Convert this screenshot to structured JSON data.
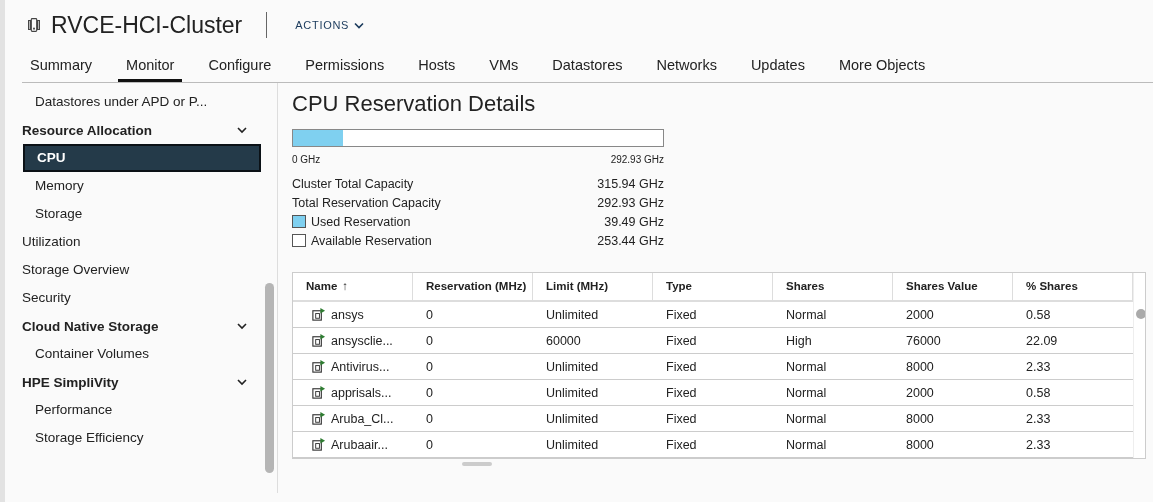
{
  "header": {
    "title": "RVCE-HCI-Cluster",
    "actions": "ACTIONS"
  },
  "tabs": [
    {
      "label": "Summary",
      "selected": false
    },
    {
      "label": "Monitor",
      "selected": true
    },
    {
      "label": "Configure",
      "selected": false
    },
    {
      "label": "Permissions",
      "selected": false
    },
    {
      "label": "Hosts",
      "selected": false
    },
    {
      "label": "VMs",
      "selected": false
    },
    {
      "label": "Datastores",
      "selected": false
    },
    {
      "label": "Networks",
      "selected": false
    },
    {
      "label": "Updates",
      "selected": false
    },
    {
      "label": "More Objects",
      "selected": false
    }
  ],
  "sidebar": {
    "items": [
      {
        "kind": "subitem",
        "label": "Datastores under APD or P...",
        "selected": false
      },
      {
        "kind": "group",
        "label": "Resource Allocation",
        "expanded": true,
        "children": [
          {
            "label": "CPU",
            "selected": true
          },
          {
            "label": "Memory",
            "selected": false
          },
          {
            "label": "Storage",
            "selected": false
          }
        ]
      },
      {
        "kind": "item",
        "label": "Utilization",
        "selected": false
      },
      {
        "kind": "item",
        "label": "Storage Overview",
        "selected": false
      },
      {
        "kind": "item",
        "label": "Security",
        "selected": false
      },
      {
        "kind": "group",
        "label": "Cloud Native Storage",
        "expanded": true,
        "children": [
          {
            "label": "Container Volumes",
            "selected": false
          }
        ]
      },
      {
        "kind": "group",
        "label": "HPE SimpliVity",
        "expanded": true,
        "children": [
          {
            "label": "Performance",
            "selected": false
          },
          {
            "label": "Storage Efficiency",
            "selected": false
          }
        ]
      }
    ]
  },
  "details": {
    "title": "CPU Reservation Details",
    "bar": {
      "level": 0.135,
      "min_label": "0 GHz",
      "max_label": "292.93 GHz"
    },
    "stats": [
      {
        "kind": "plain",
        "label": "Cluster Total Capacity",
        "value": "315.94 GHz"
      },
      {
        "kind": "plain",
        "label": "Total Reservation Capacity",
        "value": "292.93 GHz"
      },
      {
        "kind": "legend",
        "label": "Used Reservation",
        "value": "39.49 GHz",
        "color": "#7fd0f0"
      },
      {
        "kind": "legend",
        "label": "Available Reservation",
        "value": "253.44 GHz",
        "color": "#ffffff"
      }
    ]
  },
  "table": {
    "columns": [
      {
        "label": "Name",
        "sort_icon": "↑"
      },
      {
        "label": "Reservation (MHz)"
      },
      {
        "label": "Limit (MHz)"
      },
      {
        "label": "Type"
      },
      {
        "label": "Shares"
      },
      {
        "label": "Shares Value"
      },
      {
        "label": "% Shares"
      }
    ],
    "rows": [
      [
        "ansys",
        "0",
        "Unlimited",
        "Fixed",
        "Normal",
        "2000",
        "0.58"
      ],
      [
        "ansysclie...",
        "0",
        "60000",
        "Fixed",
        "High",
        "76000",
        "22.09"
      ],
      [
        "Antivirus...",
        "0",
        "Unlimited",
        "Fixed",
        "Normal",
        "8000",
        "2.33"
      ],
      [
        "apprisals...",
        "0",
        "Unlimited",
        "Fixed",
        "Normal",
        "2000",
        "0.58"
      ],
      [
        "Aruba_Cl...",
        "0",
        "Unlimited",
        "Fixed",
        "Normal",
        "8000",
        "2.33"
      ],
      [
        "Arubaair...",
        "0",
        "Unlimited",
        "Fixed",
        "Normal",
        "8000",
        "2.33"
      ]
    ]
  }
}
